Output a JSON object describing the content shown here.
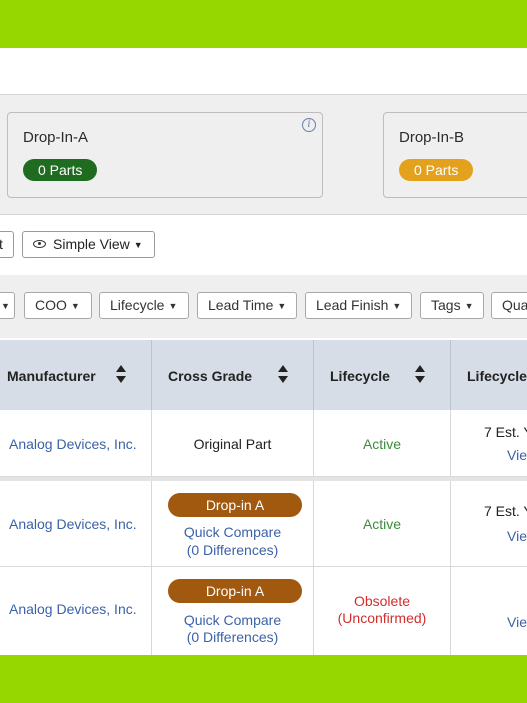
{
  "cards": [
    {
      "title": "Drop-In-A",
      "count": "0 Parts",
      "info_icon": "info-icon",
      "color": "#1f6b1f"
    },
    {
      "title": "Drop-In-B",
      "count": "0 Parts",
      "color": "#e3a11e"
    }
  ],
  "view_bar": {
    "partial_label": "t",
    "simple_view_label": "Simple View"
  },
  "filters": [
    "COO",
    "Lifecycle",
    "Lead Time",
    "Lead Finish",
    "Tags",
    "Qua"
  ],
  "table": {
    "headers": [
      "Manufacturer",
      "Cross Grade",
      "Lifecycle",
      "Lifecycle"
    ],
    "rows": [
      {
        "manufacturer": "Analog Devices, Inc.",
        "cross_grade": "Original Part",
        "lifecycle": "Active",
        "lifecycle_est": "7 Est. Y",
        "lifecycle_link": "Vie"
      },
      {
        "manufacturer": "Analog Devices, Inc.",
        "cross_grade_badge": "Drop-in A",
        "compare_line1": "Quick Compare",
        "compare_line2": "(0 Differences)",
        "lifecycle": "Active",
        "lifecycle_est": "7 Est. Y",
        "lifecycle_link": "Vie"
      },
      {
        "manufacturer": "Analog Devices, Inc.",
        "cross_grade_badge": "Drop-in A",
        "compare_line1": "Quick Compare",
        "compare_line2": "(0 Differences)",
        "lifecycle_line1": "Obsolete",
        "lifecycle_line2": "(Unconfirmed)",
        "lifecycle_link": "Vie"
      }
    ]
  },
  "colors": {
    "brand_green": "#97d700",
    "link_blue": "#3b62a8",
    "active_green": "#3d8b3d",
    "obsolete_red": "#d42d2d",
    "dropin_brown": "#a0590e"
  }
}
